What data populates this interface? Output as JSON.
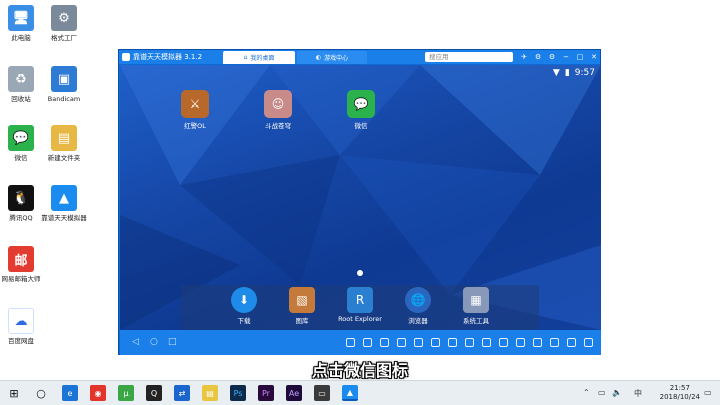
{
  "desktop": {
    "icons": [
      {
        "label": "此电脑",
        "icon": "computer-icon",
        "color": "#3a8ee6"
      },
      {
        "label": "格式工厂",
        "icon": "format-factory-icon",
        "color": "#7a8a9a"
      },
      {
        "label": "回收站",
        "icon": "recycle-bin-icon",
        "color": "#9aa7b5"
      },
      {
        "label": "Bandicam",
        "icon": "bandicam-icon",
        "color": "#2e7bd6"
      },
      {
        "label": "微信",
        "icon": "wechat-icon",
        "color": "#2bb24c"
      },
      {
        "label": "新建文件夹",
        "icon": "folder-icon",
        "color": "#e8b845"
      },
      {
        "label": "腾讯QQ",
        "icon": "qq-icon",
        "color": "#111111"
      },
      {
        "label": "靠谱天天模拟器",
        "icon": "emulator-icon",
        "color": "#1a8cf0"
      },
      {
        "label": "网易邮箱大师",
        "icon": "mail-master-icon",
        "color": "#e23b30"
      },
      {
        "label": "百度网盘",
        "icon": "baidu-netdisk-icon",
        "color": "#2f6be0"
      }
    ]
  },
  "emulator": {
    "title": "靠谱天天模拟器 3.1.2",
    "tabs": [
      "我的桌面",
      "游戏中心"
    ],
    "search_placeholder": "搜应用",
    "status": {
      "time": "9:57"
    },
    "apps": [
      {
        "label": "红警OL",
        "icon": "red-alert-icon",
        "color": "#b8682a"
      },
      {
        "label": "斗战苍穹",
        "icon": "game-avatar-icon",
        "color": "#c98a8a"
      },
      {
        "label": "微信",
        "icon": "wechat-icon",
        "color": "#2bb24c"
      }
    ],
    "dock": [
      {
        "label": "下载",
        "icon": "download-icon",
        "color": "#1e8be8"
      },
      {
        "label": "图库",
        "icon": "gallery-icon",
        "color": "#c47a3a"
      },
      {
        "label": "Root Explorer",
        "icon": "root-explorer-icon",
        "color": "#2a7fd0"
      },
      {
        "label": "浏览器",
        "icon": "browser-icon",
        "color": "#2a66c0"
      },
      {
        "label": "系统工具",
        "icon": "system-tools-icon",
        "color": "#8898b8"
      }
    ]
  },
  "subtitle": "点击微信图标",
  "taskbar": {
    "time": "21:57",
    "date": "2018/10/24",
    "ime": "中"
  }
}
